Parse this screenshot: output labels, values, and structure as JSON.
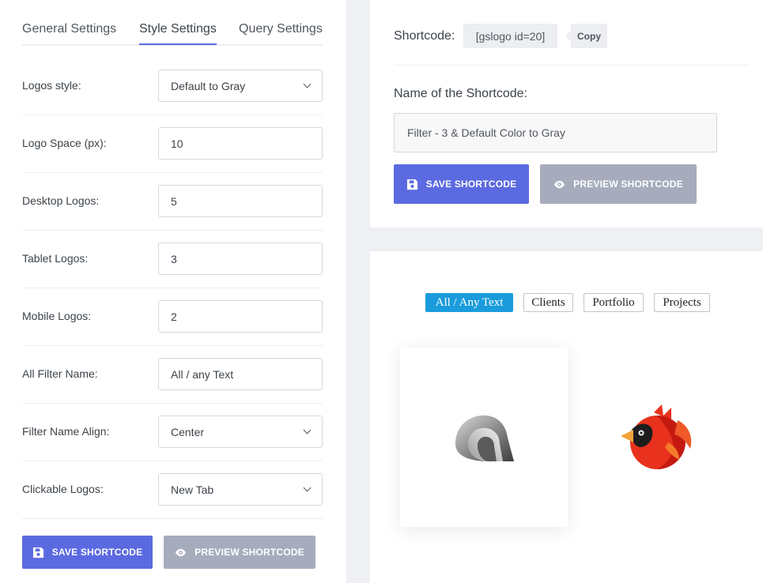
{
  "tabs": [
    {
      "label": "General Settings"
    },
    {
      "label": "Style Settings"
    },
    {
      "label": "Query Settings"
    }
  ],
  "settings": [
    {
      "label": "Logos style:",
      "value": "Default to Gray",
      "type": "select"
    },
    {
      "label": "Logo Space (px):",
      "value": "10",
      "type": "input"
    },
    {
      "label": "Desktop Logos:",
      "value": "5",
      "type": "input"
    },
    {
      "label": "Tablet Logos:",
      "value": "3",
      "type": "input"
    },
    {
      "label": "Mobile Logos:",
      "value": "2",
      "type": "input"
    },
    {
      "label": "All Filter Name:",
      "value": "All / any Text",
      "type": "input"
    },
    {
      "label": "Filter Name Align:",
      "value": "Center",
      "type": "select"
    },
    {
      "label": "Clickable Logos:",
      "value": "New Tab",
      "type": "select"
    }
  ],
  "buttons": {
    "save": "SAVE SHORTCODE",
    "preview": "PREVIEW SHORTCODE"
  },
  "shortcode": {
    "label": "Shortcode:",
    "code": "[gslogo id=20]",
    "copy": "Copy",
    "name_label": "Name of the Shortcode:",
    "name_value": "Filter - 3 & Default Color to Gray"
  },
  "preview": {
    "filters": [
      {
        "label": "All / Any Text",
        "active": true
      },
      {
        "label": "Clients",
        "active": false
      },
      {
        "label": "Portfolio",
        "active": false
      },
      {
        "label": "Projects",
        "active": false
      }
    ]
  },
  "colors": {
    "accent": "#5b6ae0",
    "muted_button": "#a7acbd",
    "filter_active": "#1a9bdc"
  }
}
